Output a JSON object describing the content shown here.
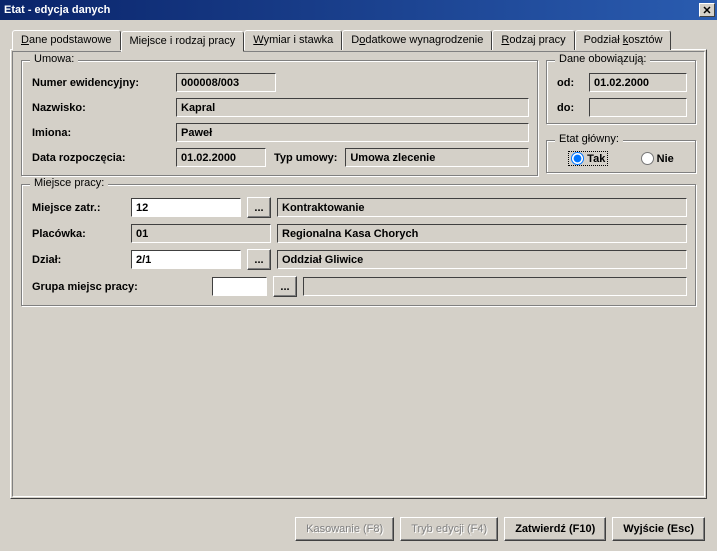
{
  "window": {
    "title": "Etat - edycja danych"
  },
  "tabs": {
    "t0": "Dane podstawowe",
    "t1": "Miejsce i rodzaj pracy",
    "t2": "Wymiar i stawka",
    "t3": "Dodatkowe wynagrodzenie",
    "t4": "Rodzaj pracy",
    "t5": "Podział kosztów"
  },
  "umowa": {
    "legend": "Umowa:",
    "numer_label": "Numer ewidencyjny:",
    "numer_value": "000008/003",
    "nazwisko_label": "Nazwisko:",
    "nazwisko_value": "Kapral",
    "imiona_label": "Imiona:",
    "imiona_value": "Paweł",
    "data_label": "Data rozpoczęcia:",
    "data_value": "01.02.2000",
    "typ_label": "Typ umowy:",
    "typ_value": "Umowa zlecenie"
  },
  "dane_obow": {
    "legend": "Dane obowiązują:",
    "od_label": "od:",
    "od_value": "01.02.2000",
    "do_label": "do:",
    "do_value": ""
  },
  "etat_glowny": {
    "legend": "Etat główny:",
    "tak": "Tak",
    "nie": "Nie"
  },
  "miejsce": {
    "legend": "Miejsce pracy:",
    "zatr_label": "Miejsce zatr.:",
    "zatr_code": "12",
    "zatr_name": "Kontraktowanie",
    "plac_label": "Placówka:",
    "plac_code": "01",
    "plac_name": "Regionalna Kasa Chorych",
    "dzial_label": "Dział:",
    "dzial_code": "2/1",
    "dzial_name": "Oddział Gliwice",
    "grupa_label": "Grupa miejsc pracy:",
    "grupa_code": "",
    "grupa_name": "",
    "dots": "..."
  },
  "buttons": {
    "kasowanie": "Kasowanie (F8)",
    "tryb": "Tryb edycji (F4)",
    "zatwierdz": "Zatwierdź (F10)",
    "wyjscie": "Wyjście (Esc)"
  }
}
